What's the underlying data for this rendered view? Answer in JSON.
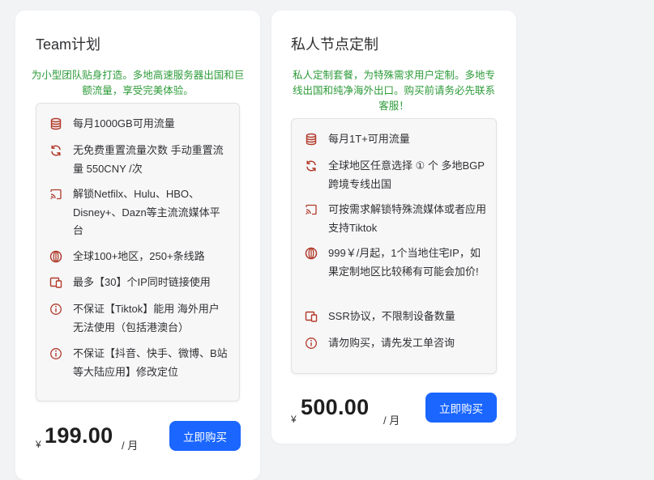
{
  "colors": {
    "accent": "#1a66ff",
    "description_green": "#2e9b3a",
    "icon_red": "#b13a2a"
  },
  "plans": [
    {
      "title": "Team计划",
      "description": "为小型团队贴身打造。多地高速服务器出国和巨额流量，享受完美体验。",
      "features": [
        {
          "icon": "database-icon",
          "text": "每月1000GB可用流量"
        },
        {
          "icon": "refresh-icon",
          "text": "无免费重置流量次数 手动重置流量 550CNY /次"
        },
        {
          "icon": "cast-icon",
          "text": "解锁Netfilx、Hulu、HBO、Disney+、Dazn等主流流媒体平台"
        },
        {
          "icon": "globe-icon",
          "text": "全球100+地区，250+条线路"
        },
        {
          "icon": "devices-icon",
          "text": "最多【30】个IP同时链接使用"
        },
        {
          "icon": "info-icon",
          "text": "不保证【Tiktok】能用 海外用户无法使用（包括港澳台）"
        },
        {
          "icon": "info-icon",
          "text": "不保证【抖音、快手、微博、B站等大陆应用】修改定位"
        }
      ],
      "currency": "¥",
      "price": "199.00",
      "unit": "/ 月",
      "button": "立即购买"
    },
    {
      "title": "私人节点定制",
      "description": "私人定制套餐，为特殊需求用户定制。多地专线出国和纯净海外出口。购买前请务必先联系客服！",
      "features": [
        {
          "icon": "database-icon",
          "text": "每月1T+可用流量"
        },
        {
          "icon": "refresh-icon",
          "text": "全球地区任意选择 ① 个 多地BGP跨境专线出国"
        },
        {
          "icon": "cast-icon",
          "text": "可按需求解锁特殊流媒体或者应用 支持Tiktok"
        },
        {
          "icon": "globe-icon",
          "text": "999￥/月起，1个当地住宅IP，如果定制地区比较稀有可能会加价!"
        },
        {
          "icon": "devices-icon",
          "text": "SSR协议，不限制设备数量"
        },
        {
          "icon": "info-icon",
          "text": "请勿购买，请先发工单咨询"
        }
      ],
      "currency": "¥",
      "price": "500.00",
      "unit": "/ 月",
      "button": "立即购买"
    }
  ]
}
